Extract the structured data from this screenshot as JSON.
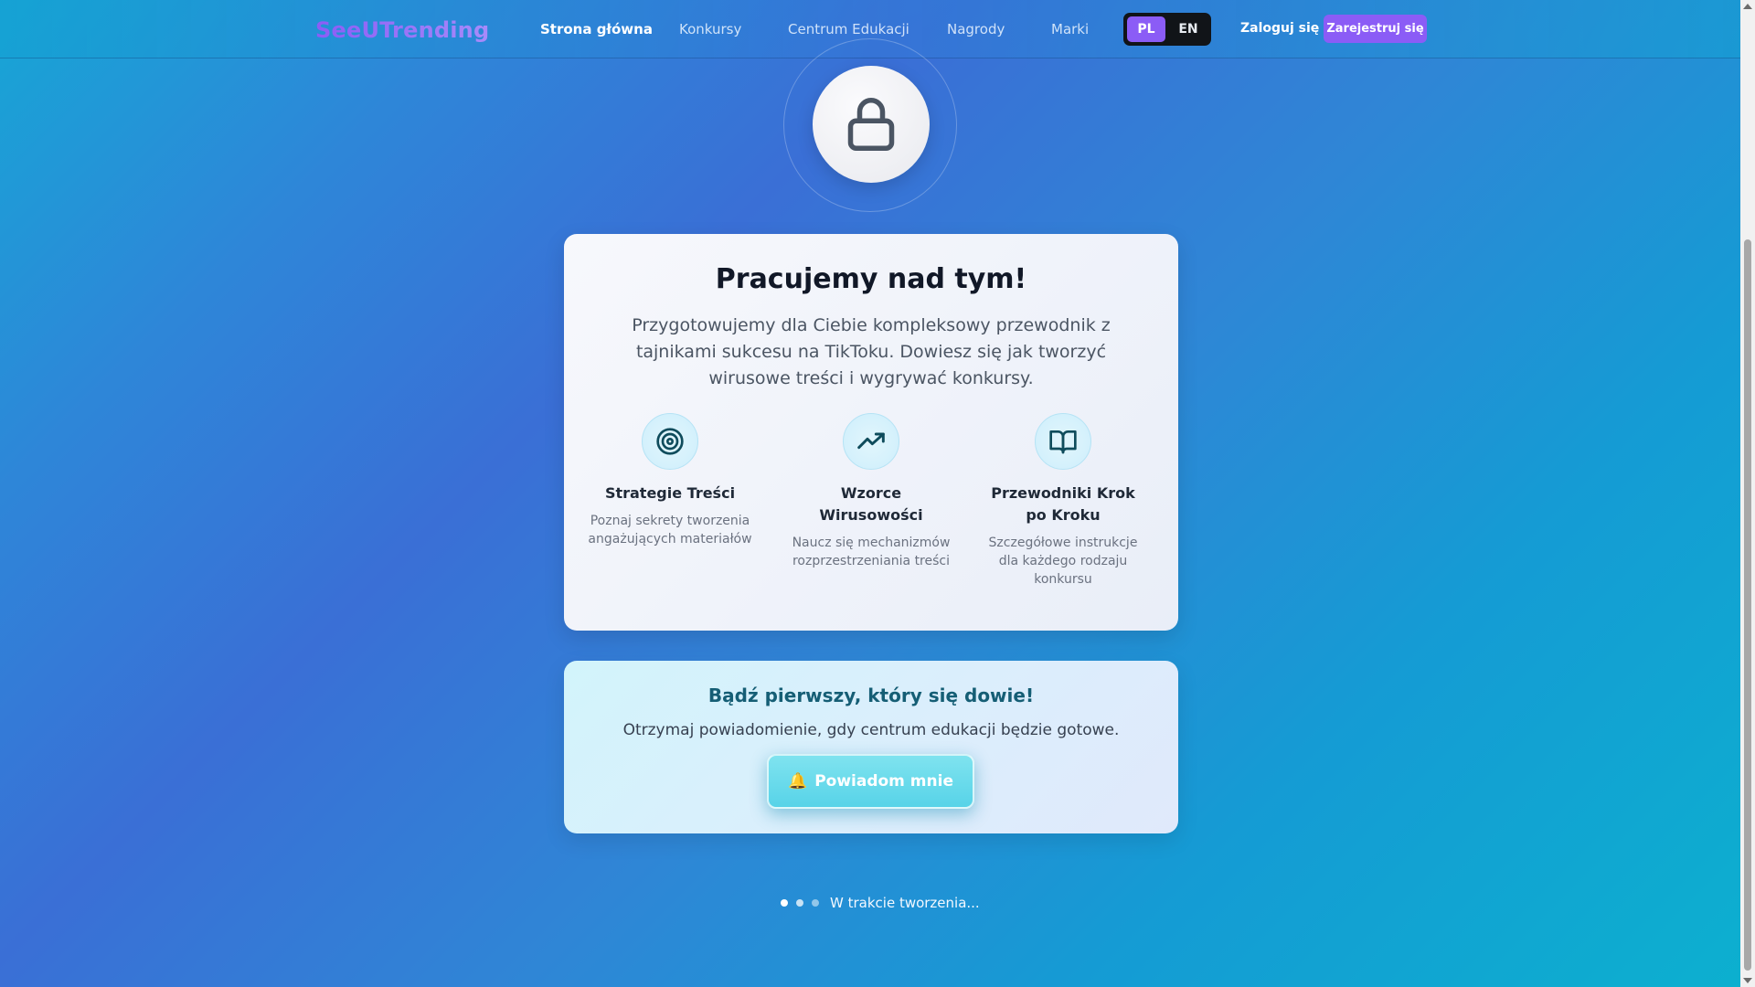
{
  "header": {
    "brand": "SeeUTrending",
    "nav": [
      {
        "label": "Strona główna",
        "active": true
      },
      {
        "label": "Konkursy"
      },
      {
        "label": "Centrum Edukacji"
      },
      {
        "label": "Nagrody"
      },
      {
        "label": "Marki"
      }
    ],
    "languages": [
      {
        "label": "PL",
        "selected": true
      },
      {
        "label": "EN",
        "selected": false
      }
    ],
    "login_label": "Zaloguj się",
    "signup_label": "Zarejestruj się"
  },
  "hero": {
    "icon": "lock-icon"
  },
  "card": {
    "title": "Pracujemy nad tym!",
    "lead": "Przygotowujemy dla Ciebie kompleksowy przewodnik z tajnikami sukcesu na TikToku. Dowiesz się jak tworzyć wirusowe treści i wygrywać konkursy.",
    "features": [
      {
        "icon": "target-icon",
        "title": "Strategie Treści",
        "desc": "Poznaj sekrety tworzenia angażujących materiałów"
      },
      {
        "icon": "trending-up-icon",
        "title": "Wzorce Wirusowości",
        "desc": "Naucz się mechanizmów rozprzestrzeniania treści"
      },
      {
        "icon": "book-open-icon",
        "title": "Przewodniki Krok po Kroku",
        "desc": "Szczegółowe instrukcje dla każdego rodzaju konkursu"
      }
    ]
  },
  "notify": {
    "title": "Bądź pierwszy, który się dowie!",
    "text": "Otrzymaj powiadomienie, gdy centrum edukacji będzie gotowe.",
    "button_icon": "🔔",
    "button_label": "Powiadom mnie"
  },
  "status": {
    "text": "W trakcie tworzenia..."
  },
  "colors": {
    "accent": "#8b5cf6",
    "teal": "#155e75",
    "icon": "#0f4c5c"
  }
}
